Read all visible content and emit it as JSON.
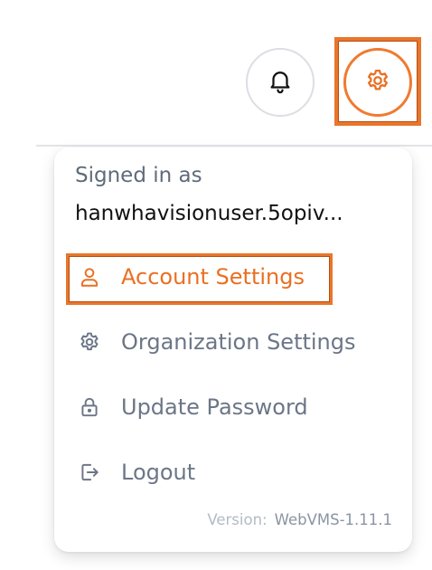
{
  "header": {
    "notifications_icon": "bell-icon",
    "settings_icon": "gear-icon"
  },
  "menu": {
    "signed_in_label": "Signed in as",
    "username": "hanwhavisionuser.5opiv...",
    "items": [
      {
        "label": "Account Settings",
        "icon": "user-icon",
        "active": true
      },
      {
        "label": "Organization Settings",
        "icon": "gear-icon",
        "active": false
      },
      {
        "label": "Update Password",
        "icon": "lock-icon",
        "active": false
      },
      {
        "label": "Logout",
        "icon": "logout-icon",
        "active": false
      }
    ],
    "version_label": "Version:",
    "version_value": "WebVMS-1.11.1"
  },
  "colors": {
    "accent": "#ea6f22",
    "muted_text": "#6b7687"
  }
}
